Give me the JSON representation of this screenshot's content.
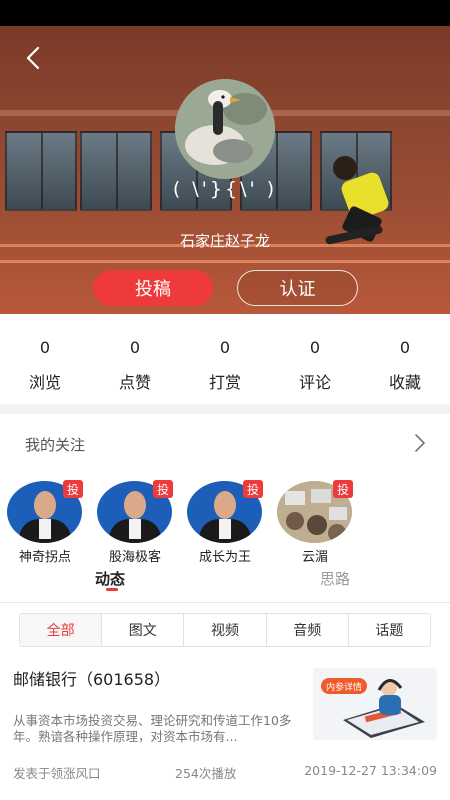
{
  "profile": {
    "nickname": "( \\'}{\\' )",
    "location": "石家庄赵子龙",
    "contribute_label": "投稿",
    "certify_label": "认证"
  },
  "stats": [
    {
      "value": "0",
      "label": "浏览"
    },
    {
      "value": "0",
      "label": "点赞"
    },
    {
      "value": "0",
      "label": "打赏"
    },
    {
      "value": "0",
      "label": "评论"
    },
    {
      "value": "0",
      "label": "收藏"
    }
  ],
  "following": {
    "title": "我的关注",
    "items": [
      {
        "name": "神奇拐点",
        "tag": "投"
      },
      {
        "name": "股海极客",
        "tag": "投"
      },
      {
        "name": "成长为王",
        "tag": "投"
      },
      {
        "name": "云湄",
        "tag": "投"
      }
    ]
  },
  "feed_tabs": {
    "dynamic": "动态",
    "thought": "思路"
  },
  "filters": [
    "全部",
    "图文",
    "视频",
    "音频",
    "话题"
  ],
  "article": {
    "title": "邮储银行（601658）",
    "excerpt": "从事资本市场投资交易、理论研究和传道工作10多年。熟谙各种操作原理，对资本市场有...",
    "thumb_badge": "内参详情",
    "source": "发表于领涨风口",
    "plays": "254次播放",
    "time": "2019-12-27 13:34:09"
  },
  "colors": {
    "accent": "#ee3a3a",
    "hero_tint": "#9a4d33"
  },
  "icons": {
    "back": "chevron-left-icon",
    "more": "chevron-right-icon"
  }
}
